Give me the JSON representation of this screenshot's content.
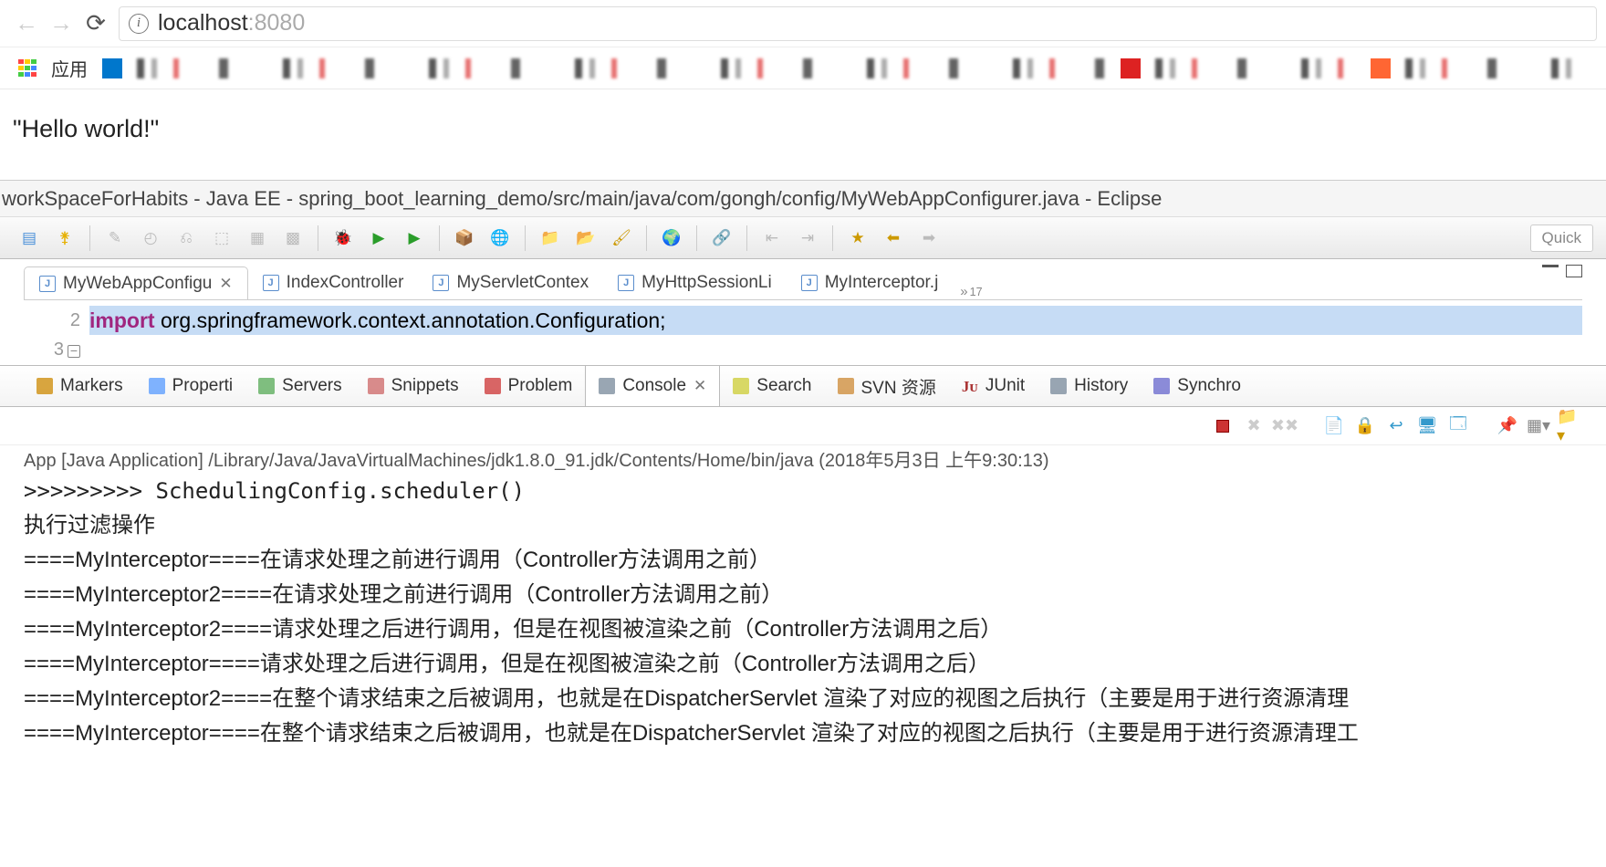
{
  "browser": {
    "url_host": "localhost",
    "url_port": ":8080",
    "apps_label": "应用"
  },
  "page": {
    "body_text": "\"Hello world!\""
  },
  "eclipse": {
    "title": "workSpaceForHabits - Java EE - spring_boot_learning_demo/src/main/java/com/gongh/config/MyWebAppConfigurer.java - Eclipse",
    "quick_access": "Quick"
  },
  "editor": {
    "tabs": [
      {
        "label": "MyWebAppConfigu",
        "active": true
      },
      {
        "label": "IndexController",
        "active": false
      },
      {
        "label": "MyServletContex",
        "active": false
      },
      {
        "label": "MyHttpSessionLi",
        "active": false
      },
      {
        "label": "MyInterceptor.j",
        "active": false
      }
    ],
    "overflow_count": "17",
    "gutter": {
      "line2": "2",
      "line3": "3"
    },
    "code": {
      "line2": "",
      "line3_keyword": "import",
      "line3_rest": " org.springframework.context.annotation.Configuration;"
    }
  },
  "views": [
    {
      "label": "Markers",
      "icon_color": "#c80"
    },
    {
      "label": "Properti",
      "icon_color": "#59f"
    },
    {
      "label": "Servers",
      "icon_color": "#5a5"
    },
    {
      "label": "Snippets",
      "icon_color": "#c66"
    },
    {
      "label": "Problem",
      "icon_color": "#c33"
    },
    {
      "label": "Console",
      "icon_color": "#789",
      "active": true
    },
    {
      "label": "Search",
      "icon_color": "#cc3"
    },
    {
      "label": "SVN 资源",
      "icon_color": "#cc8833"
    },
    {
      "label": "JUnit",
      "icon_color": "#aa3333"
    },
    {
      "label": "History",
      "icon_color": "#789"
    },
    {
      "label": "Synchro",
      "icon_color": "#66c"
    }
  ],
  "console": {
    "header": "App [Java Application] /Library/Java/JavaVirtualMachines/jdk1.8.0_91.jdk/Contents/Home/bin/java (2018年5月3日 上午9:30:13)",
    "lines": [
      ">>>>>>>>> SchedulingConfig.scheduler()",
      "执行过滤操作",
      "====MyInterceptor====在请求处理之前进行调用（Controller方法调用之前）",
      "====MyInterceptor2====在请求处理之前进行调用（Controller方法调用之前）",
      "====MyInterceptor2====请求处理之后进行调用，但是在视图被渲染之前（Controller方法调用之后）",
      "====MyInterceptor====请求处理之后进行调用，但是在视图被渲染之前（Controller方法调用之后）",
      "====MyInterceptor2====在整个请求结束之后被调用，也就是在DispatcherServlet 渲染了对应的视图之后执行（主要是用于进行资源清理",
      "====MyInterceptor====在整个请求结束之后被调用，也就是在DispatcherServlet 渲染了对应的视图之后执行（主要是用于进行资源清理工"
    ]
  }
}
